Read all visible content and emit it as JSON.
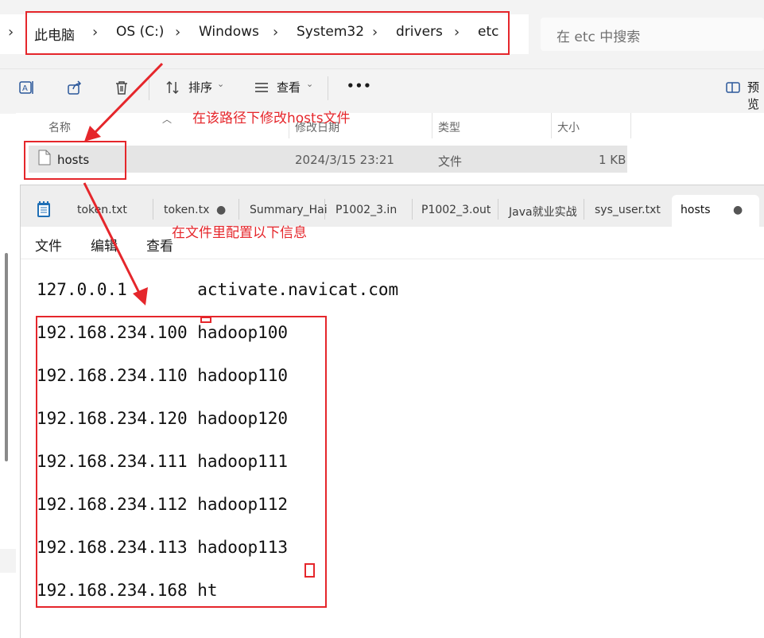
{
  "breadcrumb": [
    "此电脑",
    "OS (C:)",
    "Windows",
    "System32",
    "drivers",
    "etc"
  ],
  "search": {
    "placeholder": "在 etc 中搜索"
  },
  "toolbar": {
    "sort_label": "排序",
    "view_label": "查看",
    "more_label": "•••",
    "preview_label": "预览"
  },
  "file_list": {
    "columns": [
      "名称",
      "修改日期",
      "类型",
      "大小"
    ],
    "rows": [
      {
        "name": "hosts",
        "modified": "2024/3/15 23:21",
        "type": "文件",
        "size": "1 KB"
      }
    ]
  },
  "notepad": {
    "tabs": [
      "token.txt",
      "token.tx",
      "Summary_Hai",
      "P1002_3.in",
      "P1002_3.out",
      "Java就业实战",
      "sys_user.txt",
      "hosts"
    ],
    "active_tab": "hosts",
    "menu": [
      "文件",
      "编辑",
      "查看"
    ],
    "lines": [
      "127.0.0.1       activate.navicat.com",
      "192.168.234.100 hadoop100",
      "192.168.234.110 hadoop110",
      "192.168.234.120 hadoop120",
      "192.168.234.111 hadoop111",
      "192.168.234.112 hadoop112",
      "192.168.234.113 hadoop113",
      "192.168.234.168 ht"
    ]
  },
  "annotations": {
    "path_note": "在该路径下修改hosts文件",
    "config_note": "在文件里配置以下信息",
    "color": "#e5262b"
  }
}
